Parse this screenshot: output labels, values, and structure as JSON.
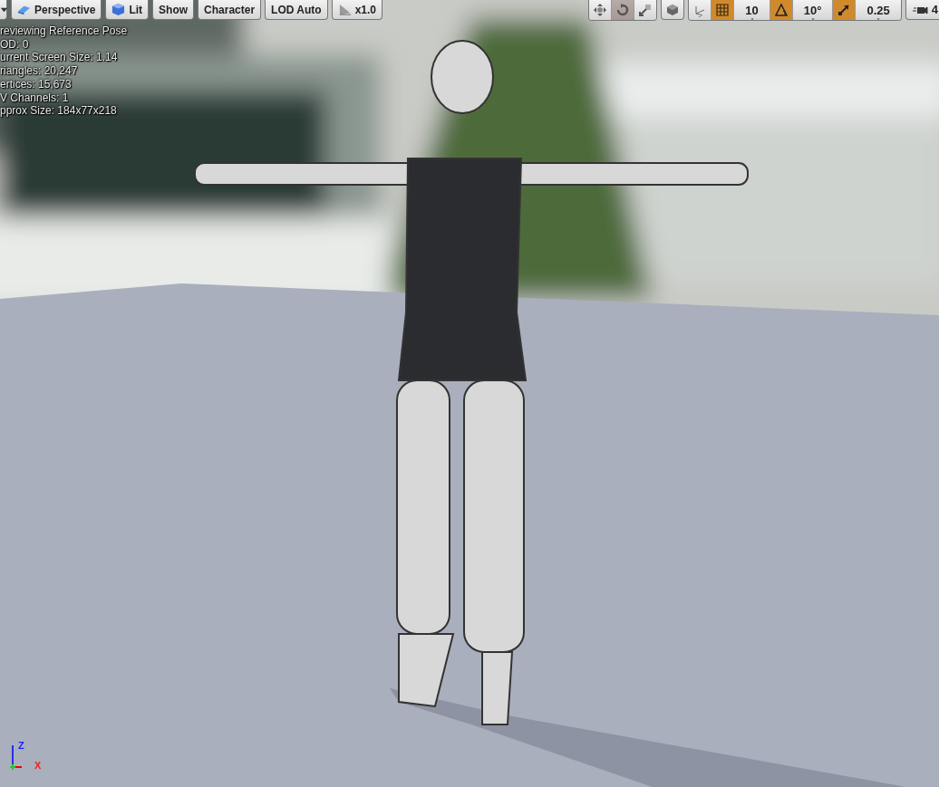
{
  "viewport_toolbar": {
    "left": [
      {
        "kind": "caret"
      },
      {
        "kind": "perspective",
        "label": "Perspective"
      },
      {
        "kind": "lit",
        "label": "Lit"
      },
      {
        "kind": "plain",
        "label": "Show"
      },
      {
        "kind": "plain",
        "label": "Character"
      },
      {
        "kind": "plain",
        "label": "LOD Auto"
      },
      {
        "kind": "speed",
        "label": "x1.0"
      }
    ],
    "transform_tools": [
      {
        "kind": "translate",
        "selected": false
      },
      {
        "kind": "rotate",
        "selected": true
      },
      {
        "kind": "scale",
        "selected": false
      }
    ],
    "snap_controls": [
      {
        "kind": "grid",
        "on": true,
        "value": "10"
      },
      {
        "kind": "rotation",
        "on": true,
        "value": "10°"
      },
      {
        "kind": "scale",
        "on": true,
        "value": "0.25"
      }
    ],
    "camera_speed": {
      "value": "4"
    }
  },
  "stats": [
    "reviewing Reference Pose",
    "OD: 0",
    "urrent Screen Size: 1.14",
    "riangles: 20,247",
    "ertices: 15,673",
    "V Channels: 1",
    "pprox Size: 184x77x218"
  ],
  "axis_gizmo": {
    "z_label": "Z",
    "x_label": "X"
  }
}
